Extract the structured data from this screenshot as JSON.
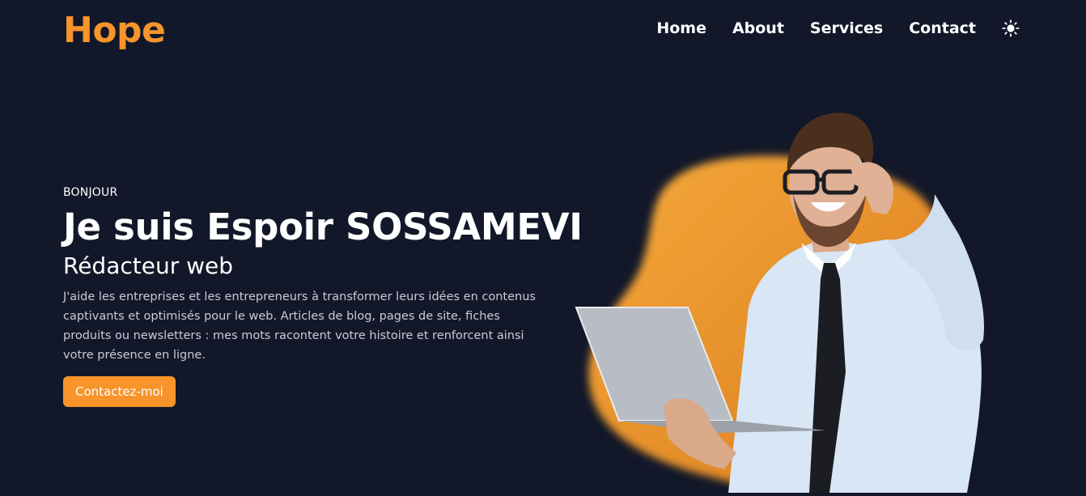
{
  "header": {
    "logo": "Hope",
    "nav": [
      "Home",
      "About",
      "Services",
      "Contact"
    ],
    "theme_icon": "sun-icon"
  },
  "hero": {
    "greeting": "BONJOUR",
    "name": "Je suis Espoir SOSSAMEVI",
    "role": "Rédacteur web",
    "description": "J'aide les entreprises et les entrepreneurs à transformer leurs idées en contenus captivants et optimisés pour le web. Articles de blog, pages de site, fiches produits ou newsletters : mes mots racontent votre histoire et renforcent ainsi votre présence en ligne.",
    "cta": "Contactez-moi"
  },
  "colors": {
    "background": "#121829",
    "accent": "#f7942b",
    "text": "#ffffff",
    "muted": "#c9ccd3"
  }
}
